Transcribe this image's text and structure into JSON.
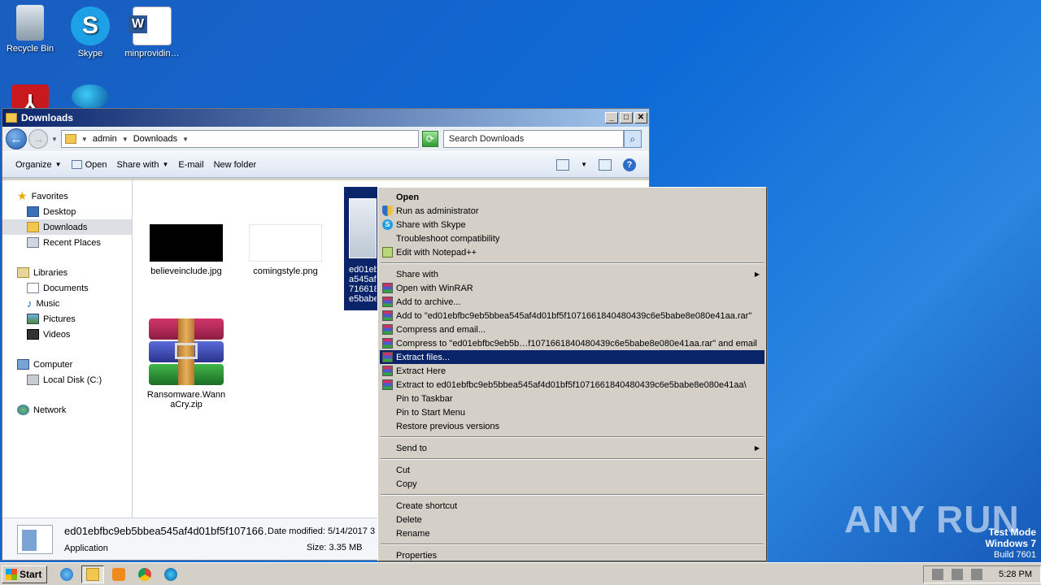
{
  "desktop": {
    "icons": [
      {
        "label": "Recycle Bin",
        "icon": "recycle-bin-icon"
      },
      {
        "label": "Skype",
        "icon": "skype-icon"
      },
      {
        "label": "minprovidin…",
        "icon": "word-document-icon"
      },
      {
        "label": "",
        "icon": "acrobat-icon"
      },
      {
        "label": "",
        "icon": "edge-icon"
      }
    ]
  },
  "window": {
    "title": "Downloads",
    "buttons": {
      "minimize": "_",
      "maximize": "□",
      "close": "✕"
    },
    "address": {
      "crumbs": [
        "admin",
        "Downloads"
      ]
    },
    "search": {
      "placeholder": "Search Downloads"
    },
    "toolbar": {
      "organize": "Organize",
      "open": "Open",
      "share_with": "Share with",
      "email": "E-mail",
      "new_folder": "New folder"
    },
    "nav": {
      "favorites": "Favorites",
      "desktop": "Desktop",
      "downloads": "Downloads",
      "recent": "Recent Places",
      "libraries": "Libraries",
      "documents": "Documents",
      "music": "Music",
      "pictures": "Pictures",
      "videos": "Videos",
      "computer": "Computer",
      "local_disk": "Local Disk (C:)",
      "network": "Network"
    },
    "files": [
      {
        "name": "believeinclude.jpg"
      },
      {
        "name": "comingstyle.png"
      },
      {
        "name": "Ransomware.WannaCry.zip"
      }
    ],
    "selected_file_label": [
      "ed01eb",
      "a545af",
      "716618",
      "e5babe"
    ],
    "details": {
      "name": "ed01ebfbc9eb5bbea545af4d01bf5f107166…",
      "type": "Application",
      "date_modified": "Date modified: 5/14/2017 3",
      "size": "Size: 3.35 MB"
    }
  },
  "context_menu": {
    "open": "Open",
    "run_as_admin": "Run as administrator",
    "share_skype": "Share with Skype",
    "troubleshoot": "Troubleshoot compatibility",
    "edit_npp": "Edit with Notepad++",
    "share_with": "Share with",
    "open_winrar": "Open with WinRAR",
    "add_archive": "Add to archive...",
    "add_to_rar": "Add to \"ed01ebfbc9eb5bbea545af4d01bf5f1071661840480439c6e5babe8e080e41aa.rar\"",
    "compress_email": "Compress and email...",
    "compress_to_email": "Compress to \"ed01ebfbc9eb5b…f1071661840480439c6e5babe8e080e41aa.rar\" and email",
    "extract_files": "Extract files...",
    "extract_here": "Extract Here",
    "extract_to": "Extract to ed01ebfbc9eb5bbea545af4d01bf5f1071661840480439c6e5babe8e080e41aa\\",
    "pin_taskbar": "Pin to Taskbar",
    "pin_start": "Pin to Start Menu",
    "restore": "Restore previous versions",
    "send_to": "Send to",
    "cut": "Cut",
    "copy": "Copy",
    "create_shortcut": "Create shortcut",
    "delete": "Delete",
    "rename": "Rename",
    "properties": "Properties"
  },
  "watermark": "ANY RUN",
  "os_info": {
    "mode": "Test Mode",
    "name": "Windows 7",
    "build": "Build 7601"
  },
  "taskbar": {
    "start": "Start",
    "clock": "5:28 PM"
  }
}
